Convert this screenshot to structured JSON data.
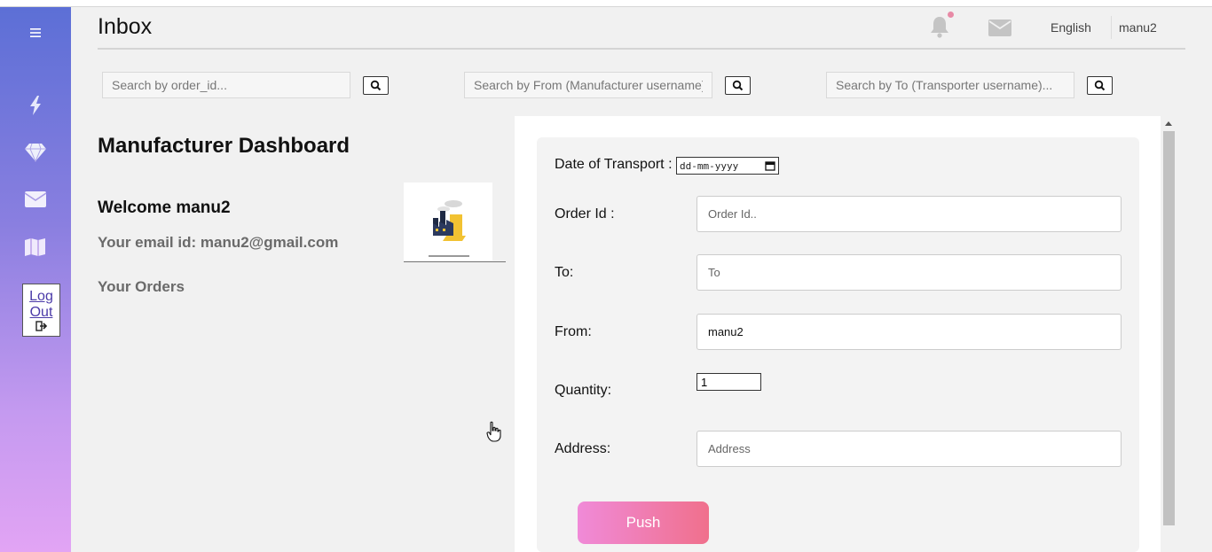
{
  "header": {
    "title": "Inbox",
    "language": "English",
    "username": "manu2"
  },
  "sidebar": {
    "items": [
      {
        "icon": "menu-icon"
      },
      {
        "icon": "bolt-icon"
      },
      {
        "icon": "diamond-icon"
      },
      {
        "icon": "mail-icon"
      },
      {
        "icon": "map-icon"
      }
    ],
    "logout_line1": "Log",
    "logout_line2": "Out"
  },
  "search": {
    "order_placeholder": "Search by order_id...",
    "from_placeholder": "Search by From (Manufacturer username)...",
    "to_placeholder": "Search by To (Transporter username)..."
  },
  "dashboard": {
    "title": "Manufacturer Dashboard",
    "welcome": "Welcome manu2",
    "email": "Your email id: manu2@gmail.com",
    "orders_heading": "Your Orders"
  },
  "form": {
    "date_label": "Date of Transport :",
    "date_placeholder": "dd-mm-yyyy",
    "order_label": "Order Id :",
    "order_placeholder": "Order Id..",
    "to_label": "To:",
    "to_placeholder": "To",
    "from_label": "From:",
    "from_value": "manu2",
    "quantity_label": "Quantity:",
    "quantity_value": "1",
    "address_label": "Address:",
    "address_placeholder": "Address",
    "submit_label": "Push"
  },
  "colors": {
    "sidebar_top": "#5c6fd6",
    "sidebar_bottom": "#e2a4f4",
    "button_start": "#f08ad8",
    "button_end": "#f0708c",
    "notification_dot": "#e88aa6"
  }
}
